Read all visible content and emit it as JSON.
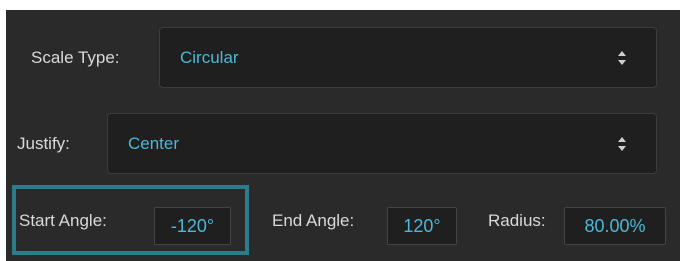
{
  "scale_type": {
    "label": "Scale Type:",
    "value": "Circular"
  },
  "justify": {
    "label": "Justify:",
    "value": "Center"
  },
  "start_angle": {
    "label": "Start Angle:",
    "value": "-120°"
  },
  "end_angle": {
    "label": "End Angle:",
    "value": "120°"
  },
  "radius": {
    "label": "Radius:",
    "value": "80.00%"
  },
  "colors": {
    "panel_bg": "#2a2a2a",
    "field_bg": "#1f1f1f",
    "value_text": "#4ab8d8",
    "label_text": "#d9d9d9",
    "highlight": "#2b7d8c"
  },
  "icons": {
    "select_arrows": "up-down-arrows-icon"
  }
}
